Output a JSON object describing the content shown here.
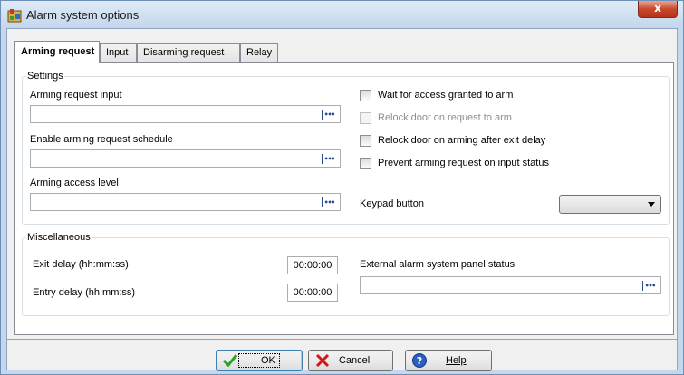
{
  "window": {
    "title": "Alarm system options",
    "close_label": "x"
  },
  "tabs": [
    {
      "label": "Arming request",
      "active": true
    },
    {
      "label": "Input",
      "active": false
    },
    {
      "label": "Disarming request",
      "active": false
    },
    {
      "label": "Relay",
      "active": false
    }
  ],
  "settings": {
    "legend": "Settings",
    "arming_request_input_label": "Arming request input",
    "arming_request_input_value": "",
    "schedule_label": "Enable arming request schedule",
    "schedule_value": "",
    "access_level_label": "Arming access level",
    "access_level_value": "",
    "browse_glyph": "•••",
    "checkboxes": [
      {
        "label": "Wait for access granted to arm",
        "checked": false,
        "enabled": true
      },
      {
        "label": "Relock door on request to arm",
        "checked": false,
        "enabled": false
      },
      {
        "label": "Relock door on arming after exit delay",
        "checked": false,
        "enabled": true
      },
      {
        "label": "Prevent arming request on input status",
        "checked": false,
        "enabled": true
      }
    ],
    "keypad_label": "Keypad button",
    "keypad_value": ""
  },
  "misc": {
    "legend": "Miscellaneous",
    "exit_delay_label": "Exit delay (hh:mm:ss)",
    "exit_delay_value": "00:00:00",
    "entry_delay_label": "Entry delay (hh:mm:ss)",
    "entry_delay_value": "00:00:00",
    "panel_status_label": "External alarm system panel status",
    "panel_status_value": ""
  },
  "buttons": {
    "ok": "OK",
    "cancel": "Cancel",
    "help": "Help"
  },
  "colors": {
    "ok_check": "#2aa12a",
    "cancel_x": "#d01818",
    "help_icon": "#2a5fc0"
  }
}
